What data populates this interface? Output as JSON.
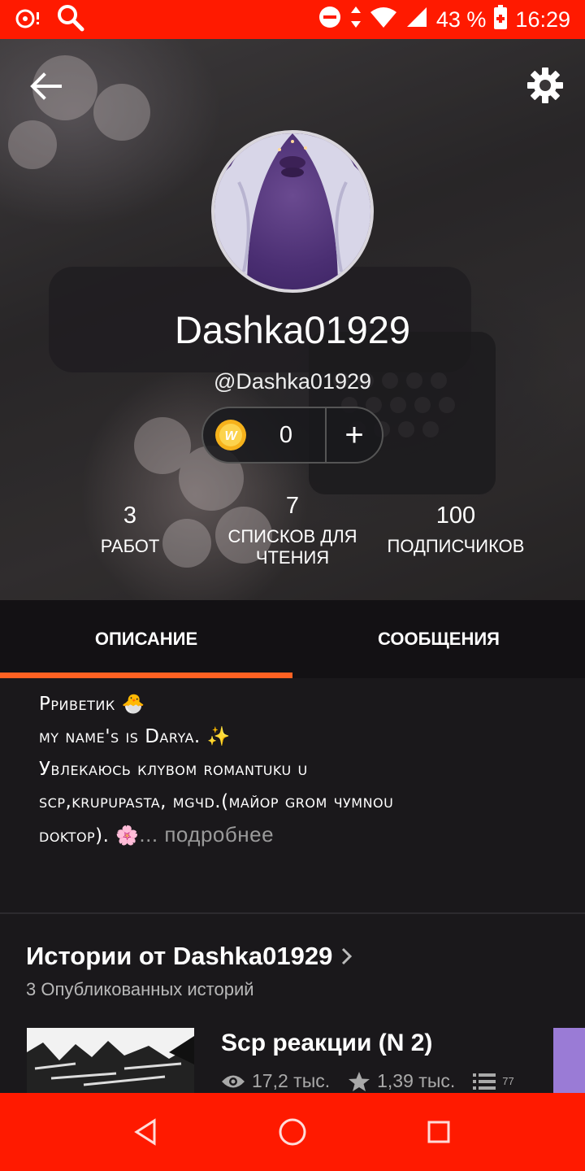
{
  "status_bar": {
    "battery": "43 %",
    "time": "16:29",
    "icons": [
      "notification-icon",
      "search-icon",
      "dnd-icon",
      "data-arrows-icon",
      "wifi-icon",
      "signal-icon",
      "battery-icon"
    ]
  },
  "profile": {
    "display_name": "Dashka01929",
    "handle": "@Dashka01929",
    "coins": "0",
    "coins_add": "+",
    "stats": [
      {
        "num": "3",
        "label": "РАБОТ"
      },
      {
        "num": "7",
        "label": "СПИСКОВ ДЛЯ ЧТЕНИЯ"
      },
      {
        "num": "100",
        "label": "ПОДПИСЧИКОВ"
      }
    ]
  },
  "tabs": [
    {
      "label": "ОПИСАНИЕ",
      "active": true
    },
    {
      "label": "СООБЩЕНИЯ",
      "active": false
    }
  ],
  "description": {
    "line1": "Pривеtик 🐣",
    "line2": "my name's is Darya. ✨",
    "line3": "Увлекаюсь клyвом romantuku u",
    "line4": "scp,krupupasta, mgчd.(майор grom чуmnou",
    "line5": "doktop). 🌸",
    "more": "... подробнее"
  },
  "stories": {
    "title": "Истории от Dashka01929",
    "subtitle": "3 Опубликованных историй",
    "items": [
      {
        "title": "Scp реакции (N 2)",
        "views": "17,2 тыс.",
        "votes": "1,39 тыс.",
        "parts": "77"
      }
    ]
  },
  "colors": {
    "status_bar": "#ff1a00",
    "tab_indicator": "#ff6122",
    "background": "#1a181b"
  }
}
